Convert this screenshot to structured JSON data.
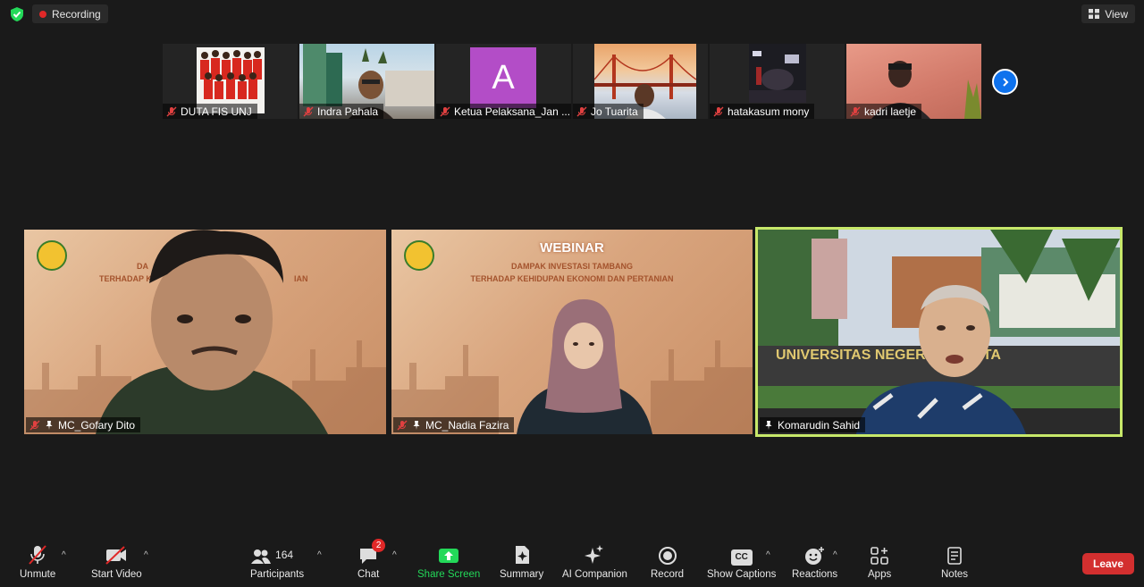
{
  "top_bar": {
    "recording_label": "Recording",
    "view_label": "View"
  },
  "thumbnails": [
    {
      "name": "DUTA FIS UNJ",
      "muted": true
    },
    {
      "name": "Indra Pahala",
      "muted": true
    },
    {
      "name": "Ketua Pelaksana_Jan ...",
      "muted": true,
      "avatar_letter": "A",
      "avatar_color": "#b34dc7"
    },
    {
      "name": "Jo Tuarita",
      "muted": true
    },
    {
      "name": "hatakasum mony",
      "muted": true
    },
    {
      "name": "kadri laetje",
      "muted": true
    }
  ],
  "tiles": [
    {
      "name": "MC_Gofary Dito",
      "muted": true,
      "pinned": true
    },
    {
      "name": "MC_Nadia Fazira",
      "muted": true,
      "pinned": true
    },
    {
      "name": "Komarudin Sahid",
      "muted": false,
      "pinned": true,
      "active_speaker": true
    }
  ],
  "webinar": {
    "heading": "WEBINAR",
    "line1": "DAMPAK INVESTASI TAMBANG",
    "line2": "TERHADAP KEHIDUPAN EKONOMI DAN  PERTANIAN",
    "partial_line1": "DA",
    "partial_line2_a": "TERHADAP K",
    "partial_line2_b": "IAN"
  },
  "toolbar": {
    "unmute": "Unmute",
    "start_video": "Start Video",
    "participants": "Participants",
    "participant_count": "164",
    "chat": "Chat",
    "chat_badge": "2",
    "share_screen": "Share Screen",
    "summary": "Summary",
    "ai_companion": "AI Companion",
    "record": "Record",
    "show_captions": "Show Captions",
    "cc": "CC",
    "reactions": "Reactions",
    "apps": "Apps",
    "notes": "Notes",
    "leave": "Leave"
  },
  "colors": {
    "active_border": "#c7e86a",
    "share_green": "#23d959",
    "leave_red": "#d32f2f",
    "accent_blue": "#0e72ed"
  }
}
